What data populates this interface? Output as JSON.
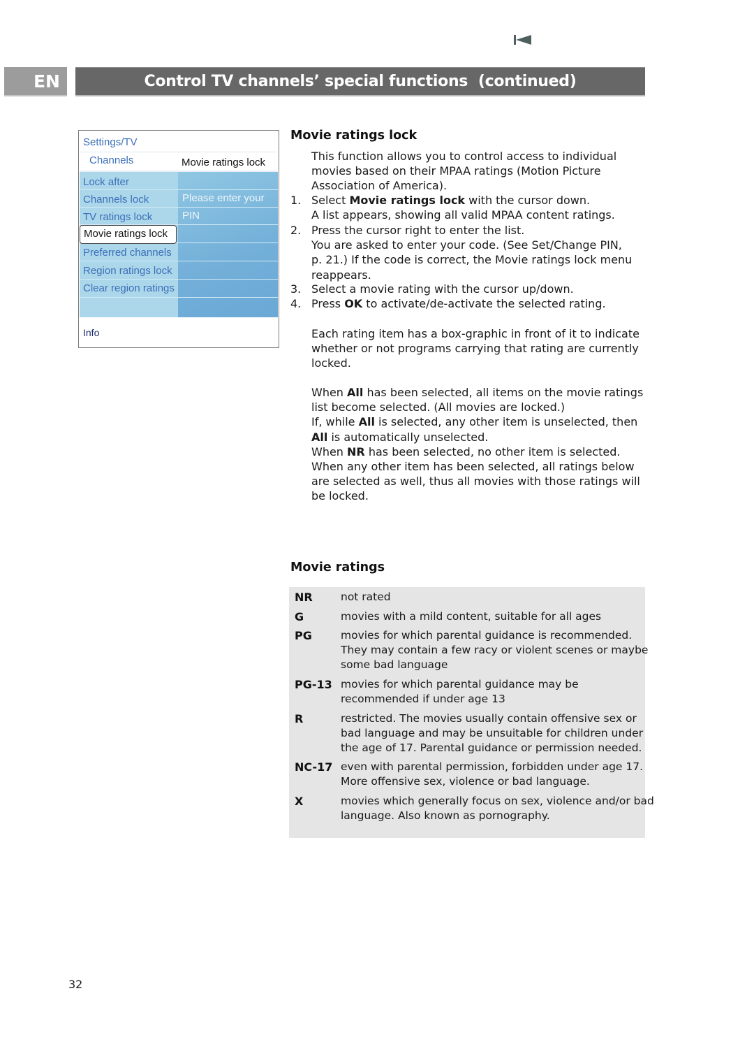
{
  "header": {
    "nav_icon": "skip-back-icon",
    "language": "EN",
    "title": "Control TV channels’ special functions  (continued)",
    "colors": {
      "language_tab": "#9c9c9c",
      "title_bar": "#676767"
    }
  },
  "tv_menu": {
    "breadcrumb": "Settings/TV",
    "section": "Channels",
    "panel_title": "Movie ratings lock",
    "items": [
      {
        "label": "Lock after"
      },
      {
        "label": "Channels lock"
      },
      {
        "label": "TV ratings lock"
      },
      {
        "label": "Movie ratings lock",
        "selected": true
      },
      {
        "label": "Preferred channels"
      },
      {
        "label": "Region ratings lock"
      },
      {
        "label": "Clear region ratings"
      }
    ],
    "prompt_line1": "Please enter your",
    "prompt_line2": "PIN",
    "info_label": "Info",
    "colors": {
      "item_text": "#3b70b8",
      "left_bg": "#acd6ea",
      "right_bg": "#74b0d9"
    }
  },
  "section_lock": {
    "heading": "Movie ratings lock",
    "intro": [
      "This function allows you to control access to individual",
      "movies based on their MPAA ratings (Motion Picture",
      "Association of America)."
    ],
    "steps": [
      {
        "num": "1.",
        "lines": [
          {
            "pre": "Select ",
            "bold": "Movie ratings lock",
            "post": " with the cursor down."
          },
          {
            "pre": "A list appears, showing all valid MPAA content ratings.",
            "bold": "",
            "post": ""
          }
        ]
      },
      {
        "num": "2.",
        "lines": [
          {
            "pre": "Press the cursor right to enter the list.",
            "bold": "",
            "post": ""
          },
          {
            "pre": "You are asked to enter your code. (See Set/Change PIN,",
            "bold": "",
            "post": ""
          },
          {
            "pre": "p. 21.) If the code is correct, the Movie ratings lock menu",
            "bold": "",
            "post": ""
          },
          {
            "pre": "reappears.",
            "bold": "",
            "post": ""
          }
        ]
      },
      {
        "num": "3.",
        "lines": [
          {
            "pre": "Select a movie rating with the cursor up/down.",
            "bold": "",
            "post": ""
          }
        ]
      },
      {
        "num": "4.",
        "lines": [
          {
            "pre": "Press ",
            "bold": "OK",
            "post": " to activate/de-activate the selected rating."
          }
        ]
      }
    ],
    "box_graphic_note": [
      "Each rating item has a box-graphic in front of it to indicate",
      "whether or not programs carrying that rating are currently",
      "locked."
    ],
    "selection_rules": [
      {
        "pre": "When ",
        "bold": "All",
        "post": " has been selected, all items on the movie ratings"
      },
      {
        "pre": "list become selected. (All movies are locked.)",
        "bold": "",
        "post": ""
      },
      {
        "pre": "If, while ",
        "bold": "All",
        "post": " is selected, any other item is unselected, then"
      },
      {
        "pre": "",
        "bold": "All",
        "post": " is automatically unselected."
      },
      {
        "pre": "When ",
        "bold": "NR",
        "post": " has been selected, no other item is selected."
      },
      {
        "pre": "When any other item has been selected, all ratings below",
        "bold": "",
        "post": ""
      },
      {
        "pre": "are selected as well, thus all movies with those ratings will",
        "bold": "",
        "post": ""
      },
      {
        "pre": "be locked.",
        "bold": "",
        "post": ""
      }
    ]
  },
  "section_ratings": {
    "heading": "Movie ratings",
    "table_bg": "#e5e5e5",
    "ratings": [
      {
        "code": "NR",
        "lines": [
          "not rated"
        ]
      },
      {
        "code": "G",
        "lines": [
          "movies with a mild content, suitable for all ages"
        ]
      },
      {
        "code": "PG",
        "lines": [
          "movies for which parental guidance is recommended.",
          "They may contain a few racy or violent scenes or maybe",
          "some bad language"
        ]
      },
      {
        "code": "PG-13",
        "lines": [
          "movies for which parental guidance may be",
          "recommended if under age 13"
        ]
      },
      {
        "code": "R",
        "lines": [
          "restricted. The movies usually contain offensive sex or",
          "bad language and may be unsuitable for children under",
          "the age of 17. Parental guidance or permission needed."
        ]
      },
      {
        "code": "NC-17",
        "lines": [
          "even with parental permission, forbidden under age 17.",
          "More offensive sex, violence or bad language."
        ]
      },
      {
        "code": "X",
        "lines": [
          "movies which generally focus on sex, violence and/or bad",
          "language. Also known as pornography."
        ]
      }
    ]
  },
  "footer": {
    "page_number": "32"
  }
}
